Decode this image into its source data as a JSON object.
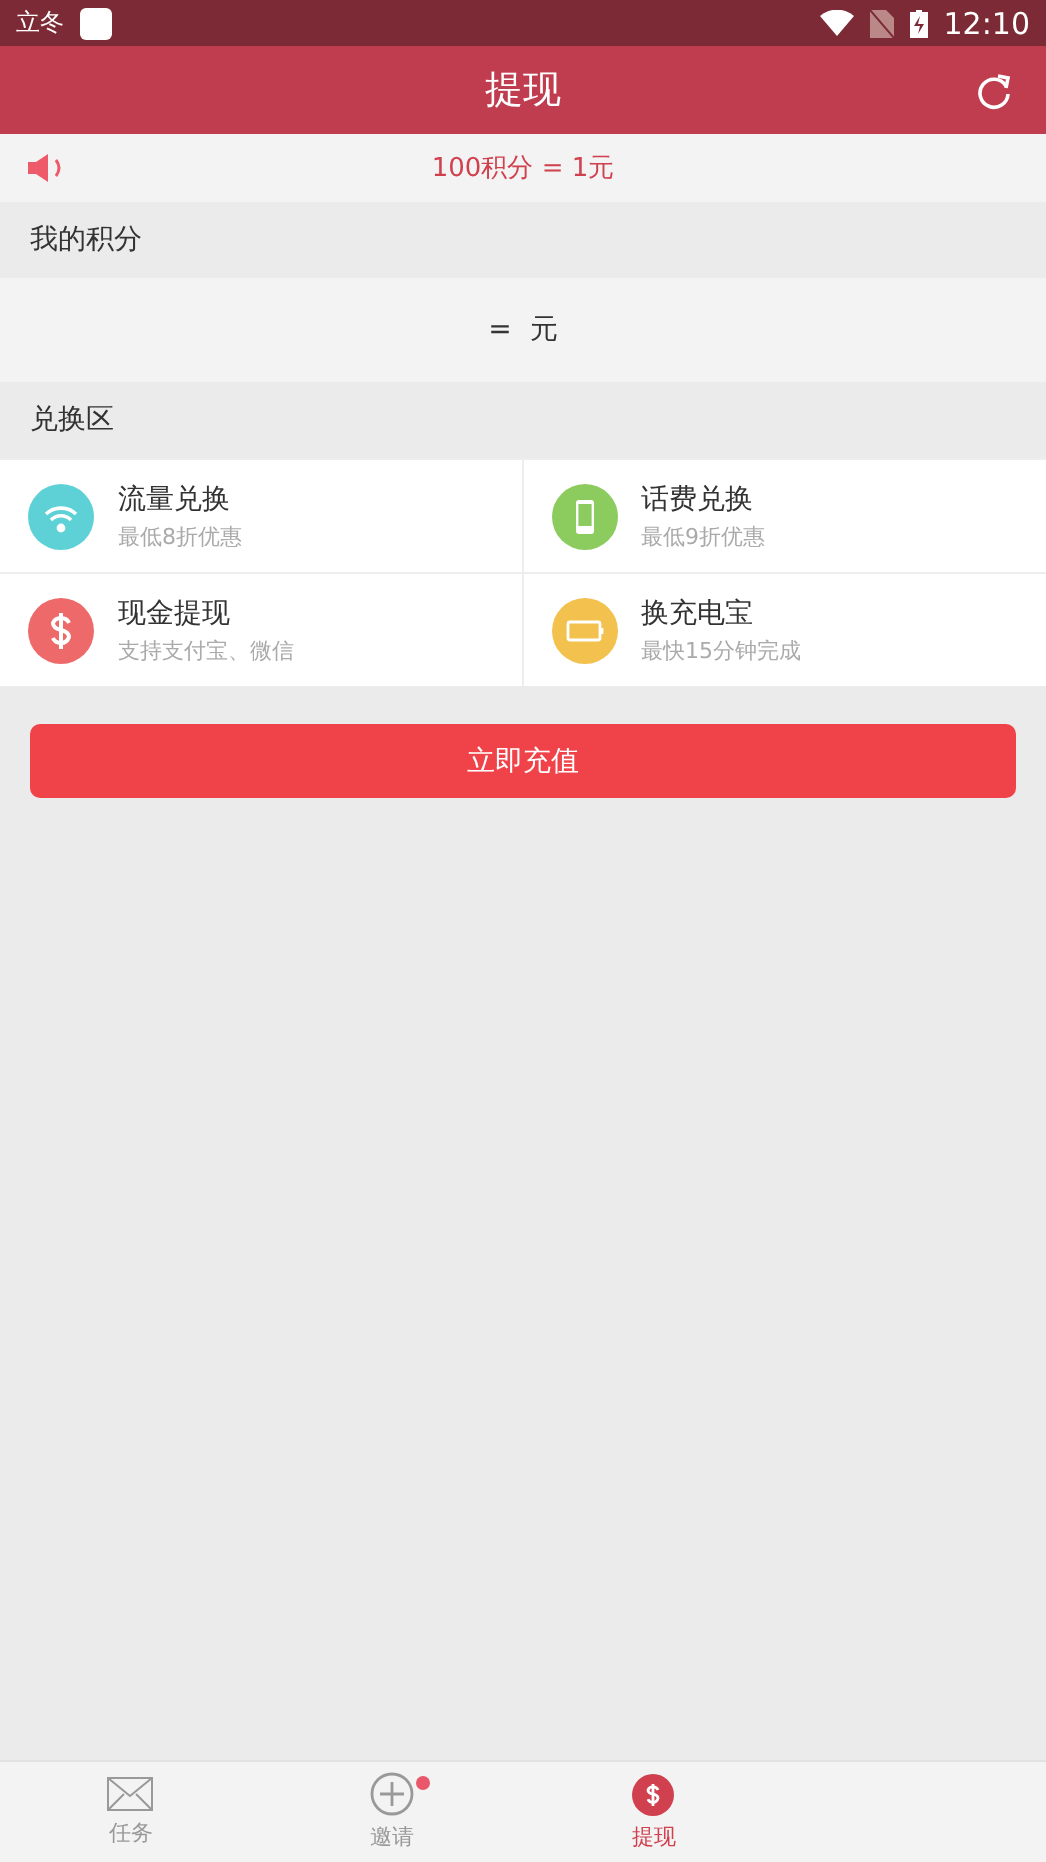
{
  "status_bar": {
    "label": "立冬",
    "time": "12:10"
  },
  "header": {
    "title": "提现"
  },
  "notice": {
    "text": "100积分 = 1元"
  },
  "points": {
    "heading": "我的积分",
    "value": "=  元"
  },
  "exchange": {
    "heading": "兑换区",
    "items": [
      {
        "kind": "wifi",
        "title": "流量兑换",
        "subtitle": "最低8折优惠",
        "color": "#5dd1d6"
      },
      {
        "kind": "phone",
        "title": "话费兑换",
        "subtitle": "最低9折优惠",
        "color": "#8ccb5e"
      },
      {
        "kind": "cash",
        "title": "现金提现",
        "subtitle": "支持支付宝、微信",
        "color": "#ee6a6a"
      },
      {
        "kind": "battery",
        "title": "换充电宝",
        "subtitle": "最快15分钟完成",
        "color": "#f2c14e"
      }
    ]
  },
  "action_button": "立即充值",
  "bottom_nav": [
    {
      "kind": "mail",
      "label": "任务",
      "selected": false,
      "badge": false
    },
    {
      "kind": "plus",
      "label": "邀请",
      "selected": false,
      "badge": true
    },
    {
      "kind": "dollar",
      "label": "提现",
      "selected": true,
      "badge": false
    }
  ]
}
